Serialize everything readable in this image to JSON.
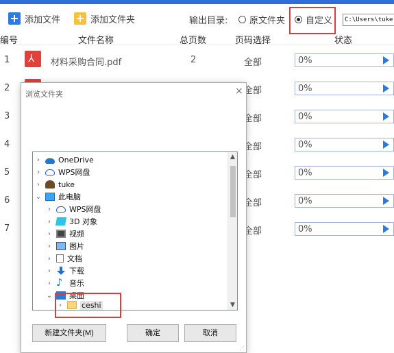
{
  "toolbar": {
    "add_file": "添加文件",
    "add_folder": "添加文件夹",
    "output_dir_label": "输出目录:",
    "option_original": "原文件夹",
    "option_custom": "自定义",
    "custom_selected": true,
    "path_value": "C:\\Users\\tuke"
  },
  "table": {
    "headers": {
      "num": "编号",
      "name": "文件名称",
      "pages": "总页数",
      "range": "页码选择",
      "status": "状态"
    },
    "rows": [
      {
        "num": "1",
        "name": "材料采购合同.pdf",
        "pages": "2",
        "range": "全部",
        "progress": "0%",
        "progress_value": 0
      },
      {
        "num": "2",
        "name": "",
        "pages": "",
        "range": "全部",
        "progress": "0%",
        "progress_value": 0
      },
      {
        "num": "3",
        "name": "",
        "pages": "",
        "range": "全部",
        "progress": "0%",
        "progress_value": 0
      },
      {
        "num": "4",
        "name": "",
        "pages": "",
        "range": "全部",
        "progress": "0%",
        "progress_value": 0
      },
      {
        "num": "5",
        "name": "",
        "pages": "",
        "range": "全部",
        "progress": "0%",
        "progress_value": 0
      },
      {
        "num": "6",
        "name": "",
        "pages": "",
        "range": "全部",
        "progress": "0%",
        "progress_value": 0
      },
      {
        "num": "7",
        "name": "",
        "pages": "",
        "range": "全部",
        "progress": "0%",
        "progress_value": 0
      }
    ]
  },
  "dialog": {
    "title": "浏览文件夹",
    "close": "×",
    "tree": {
      "onedrive": "OneDrive",
      "wps_cloud": "WPS网盘",
      "user": "tuke",
      "this_pc": "此电脑",
      "pc_wps": "WPS网盘",
      "objects3d": "3D 对象",
      "videos": "视频",
      "pictures": "图片",
      "documents": "文档",
      "downloads": "下载",
      "music": "音乐",
      "desktop": "桌面",
      "ceshi": "ceshi"
    },
    "new_folder": "新建文件夹(M)",
    "ok": "确定",
    "cancel": "取消"
  },
  "colors": {
    "accent": "#2f6fd6",
    "highlight": "#e53935",
    "pdf": "#e0413a"
  }
}
